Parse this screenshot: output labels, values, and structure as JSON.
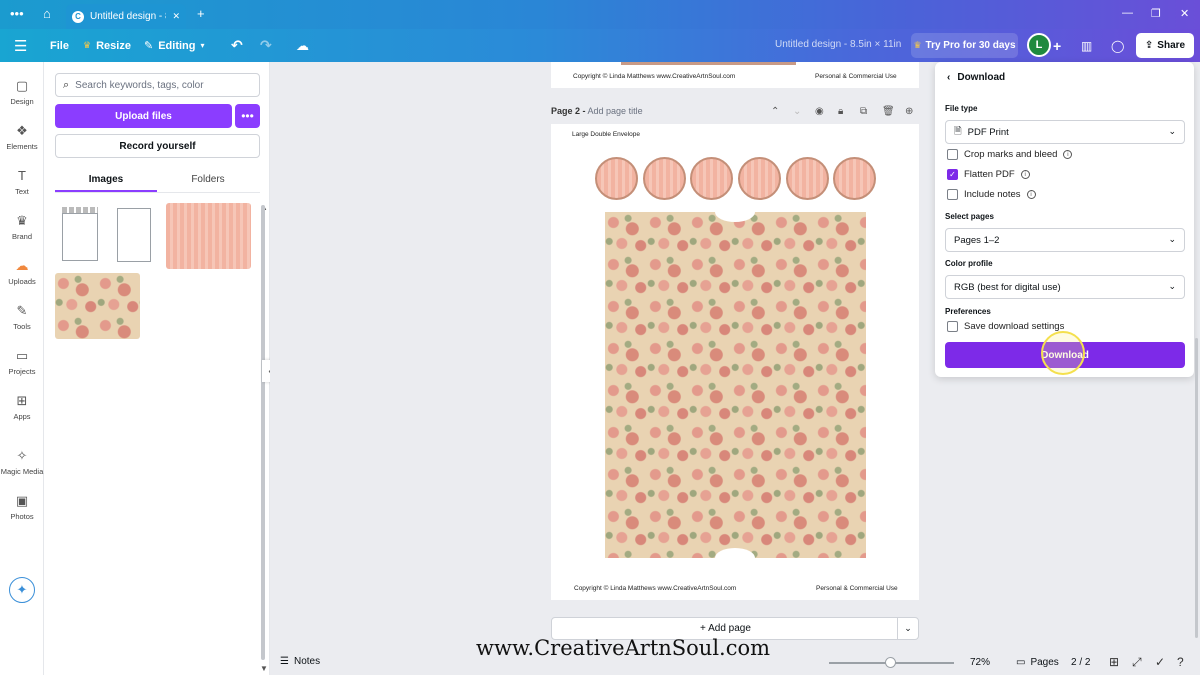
{
  "browser": {
    "tab_title": "Untitled design - 8...",
    "menu_glyph": "•••",
    "home_glyph": "⌂",
    "new_tab_glyph": "+",
    "minimize_glyph": "—",
    "restore_glyph": "❐",
    "close_glyph": "✕"
  },
  "toolbar": {
    "file": "File",
    "resize": "Resize",
    "editing": "Editing",
    "doc_title": "Untitled design - 8.5in × 11in",
    "try_pro": "Try Pro for 30 days",
    "avatar_initial": "L",
    "share": "Share",
    "accent": "#8b3dff"
  },
  "rail": {
    "items": [
      {
        "label": "Design",
        "icon": "design-icon",
        "glyph": "▢"
      },
      {
        "label": "Elements",
        "icon": "elements-icon",
        "glyph": "❖"
      },
      {
        "label": "Text",
        "icon": "text-icon",
        "glyph": "T"
      },
      {
        "label": "Brand",
        "icon": "brand-icon",
        "glyph": "♛"
      },
      {
        "label": "Uploads",
        "icon": "uploads-icon",
        "glyph": "☁"
      },
      {
        "label": "Tools",
        "icon": "tools-icon",
        "glyph": "✎"
      },
      {
        "label": "Projects",
        "icon": "projects-icon",
        "glyph": "▭"
      },
      {
        "label": "Apps",
        "icon": "apps-icon",
        "glyph": "⊞"
      },
      {
        "label": "Magic Media",
        "icon": "magic-media-icon",
        "glyph": "✧"
      },
      {
        "label": "Photos",
        "icon": "photos-icon",
        "glyph": "▣"
      }
    ]
  },
  "panel": {
    "search_placeholder": "Search keywords, tags, color",
    "upload_files": "Upload files",
    "more": "•••",
    "record_yourself": "Record yourself",
    "tabs": [
      {
        "label": "Images",
        "active": true
      },
      {
        "label": "Folders",
        "active": false
      }
    ]
  },
  "canvas": {
    "page1_copyright": "Copyright © Linda Matthews www.CreativeArtnSoul.com",
    "page1_use": "Personal & Commercial Use",
    "page2_label": "Page 2 -",
    "page2_title_placeholder": "Add page title",
    "envelope_label": "Large Double Envelope",
    "page2_copyright": "Copyright © Linda Matthews www.CreativeArtnSoul.com",
    "page2_use": "Personal & Commercial Use",
    "add_page": "+ Add page"
  },
  "download": {
    "title": "Download",
    "file_type_label": "File type",
    "file_type_value": "PDF Print",
    "options": [
      {
        "label": "Crop marks and bleed",
        "checked": false,
        "info": true
      },
      {
        "label": "Flatten PDF",
        "checked": true,
        "info": true
      },
      {
        "label": "Include notes",
        "checked": false,
        "info": true
      }
    ],
    "select_pages_label": "Select pages",
    "select_pages_value": "Pages 1–2",
    "color_profile_label": "Color profile",
    "color_profile_value": "RGB (best for digital use)",
    "preferences_label": "Preferences",
    "save_settings": "Save download settings",
    "download_button": "Download"
  },
  "footer": {
    "notes": "Notes",
    "watermark": "www.CreativeArtnSoul.com",
    "zoom": "72%",
    "pages": "Pages",
    "page_count": "2 / 2"
  }
}
